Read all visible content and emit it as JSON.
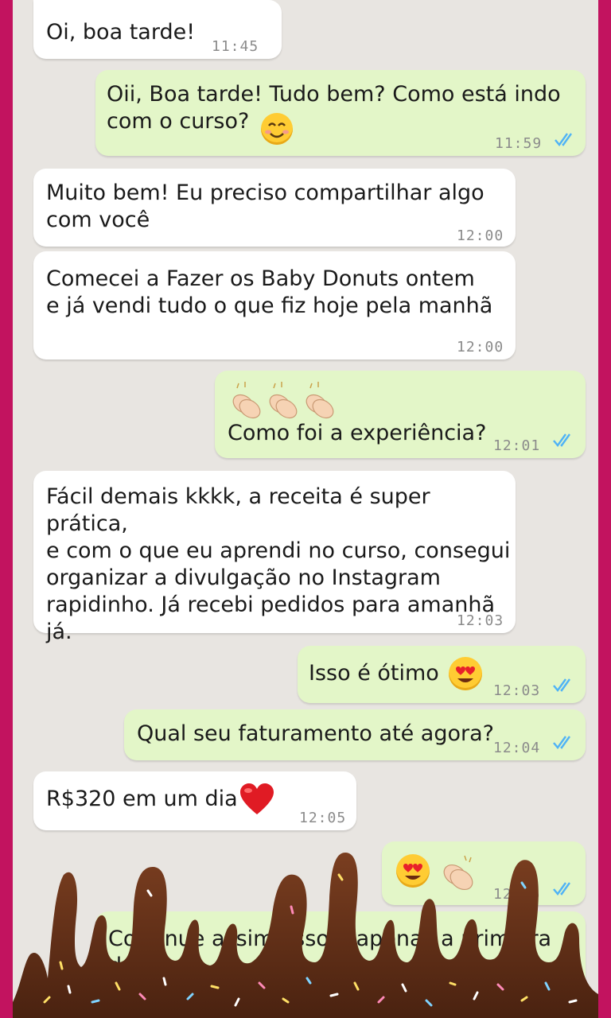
{
  "messages": [
    {
      "dir": "in",
      "text": "Oi, boa tarde!",
      "time": "11:45"
    },
    {
      "dir": "out",
      "text": "Oii, Boa tarde! Tudo bem? Como está indo\ncom o curso?",
      "time": "11:59",
      "emoji": "smiling-face"
    },
    {
      "dir": "in",
      "text": "Muito bem! Eu preciso compartilhar algo\ncom você",
      "time": "12:00"
    },
    {
      "dir": "in",
      "text": "Comecei a Fazer os Baby Donuts ontem\ne já vendi tudo o que fiz hoje pela manhã",
      "time": "12:00"
    },
    {
      "dir": "out",
      "text": "Como foi a experiência?",
      "time": "12:01",
      "emoji": "clapping-hands-x3"
    },
    {
      "dir": "in",
      "text": "Fácil demais kkkk, a receita é super prática,\ne com o que eu aprendi no curso, consegui\norganizar a divulgação no Instagram\nrapidinho. Já recebi pedidos para amanhã\njá.",
      "time": "12:03"
    },
    {
      "dir": "out",
      "text": "Isso é ótimo",
      "time": "12:03",
      "emoji": "heart-eyes-face"
    },
    {
      "dir": "out",
      "text": "Qual seu faturamento até agora?",
      "time": "12:04"
    },
    {
      "dir": "in",
      "text": "R$320 em um dia",
      "time": "12:05",
      "emoji": "red-heart"
    },
    {
      "dir": "out",
      "text": "",
      "time": "12:06",
      "emoji": "heart-eyes-face-and-clapping-hands"
    },
    {
      "dir": "out",
      "text": "Continue assim, isso é apenas a primeira\nd",
      "time": ""
    }
  ],
  "colors": {
    "frame": "#c2135f",
    "chat_background": "#e8e5e1",
    "incoming_bubble": "#ffffff",
    "outgoing_bubble": "#e3f6c8",
    "read_ticks": "#4fb3f6",
    "chocolate": "#5b2b16"
  },
  "decoration": "chocolate-drip-with-sprinkles"
}
